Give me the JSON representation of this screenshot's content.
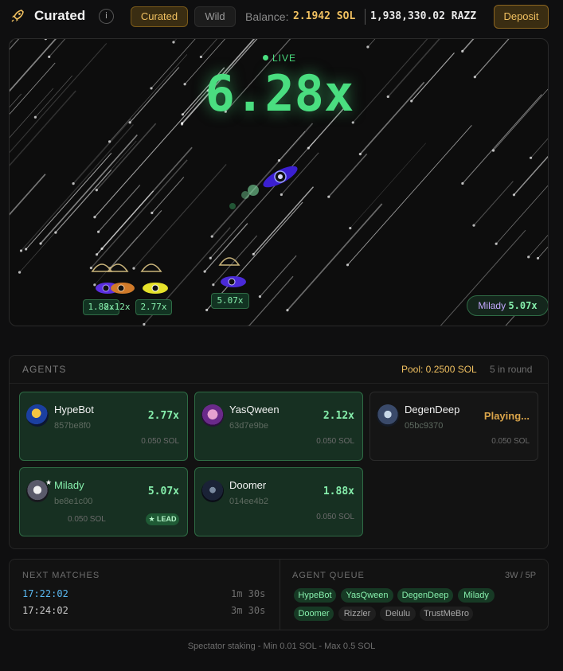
{
  "header": {
    "title": "Curated",
    "info_label": "i",
    "tabs": [
      {
        "label": "Curated",
        "active": true
      },
      {
        "label": "Wild",
        "active": false
      }
    ],
    "balance_label": "Balance:",
    "balance_sol": "2.1942 SOL",
    "balance_razz": "1,938,330.02 RAZZ",
    "deposit_label": "Deposit"
  },
  "game": {
    "status": "LIVE",
    "multiplier": "6.28x",
    "tags": [
      "1.88x",
      "2.12x",
      "2.77x",
      "5.07x"
    ],
    "leader": {
      "name": "Milady",
      "multiplier": "5.07x"
    }
  },
  "agents": {
    "heading": "AGENTS",
    "pool": "Pool: 0.2500 SOL",
    "in_round": "5 in round",
    "cards": [
      {
        "name": "HypeBot",
        "addr": "857be8f0",
        "multiplier": "2.77x",
        "stake": "0.050 SOL"
      },
      {
        "name": "YasQween",
        "addr": "63d7e9be",
        "multiplier": "2.12x",
        "stake": "0.050 SOL"
      },
      {
        "name": "DegenDeep",
        "addr": "05bc9370",
        "multiplier": "Playing...",
        "stake": "0.050 SOL"
      },
      {
        "name": "Milady",
        "addr": "be8e1c00",
        "multiplier": "5.07x",
        "stake": "0.050 SOL",
        "badge": "★ LEAD"
      },
      {
        "name": "Doomer",
        "addr": "014ee4b2",
        "multiplier": "1.88x",
        "stake": "0.050 SOL"
      }
    ]
  },
  "next_matches": {
    "heading": "NEXT MATCHES",
    "items": [
      {
        "time": "17:22:02",
        "countdown": "1m 30s"
      },
      {
        "time": "17:24:02",
        "countdown": "3m 30s"
      }
    ]
  },
  "queue": {
    "heading": "AGENT QUEUE",
    "count": "3W / 5P",
    "items": [
      "HypeBot",
      "YasQween",
      "DegenDeep",
      "Milady",
      "Doomer",
      "Rizzler",
      "Delulu",
      "TrustMeBro"
    ]
  },
  "footer": "Spectator staking - Min 0.01 SOL - Max 0.5 SOL",
  "colors": {
    "accent_gold": "#f0c060",
    "accent_green": "#4ade80",
    "background": "#0f0f10"
  }
}
